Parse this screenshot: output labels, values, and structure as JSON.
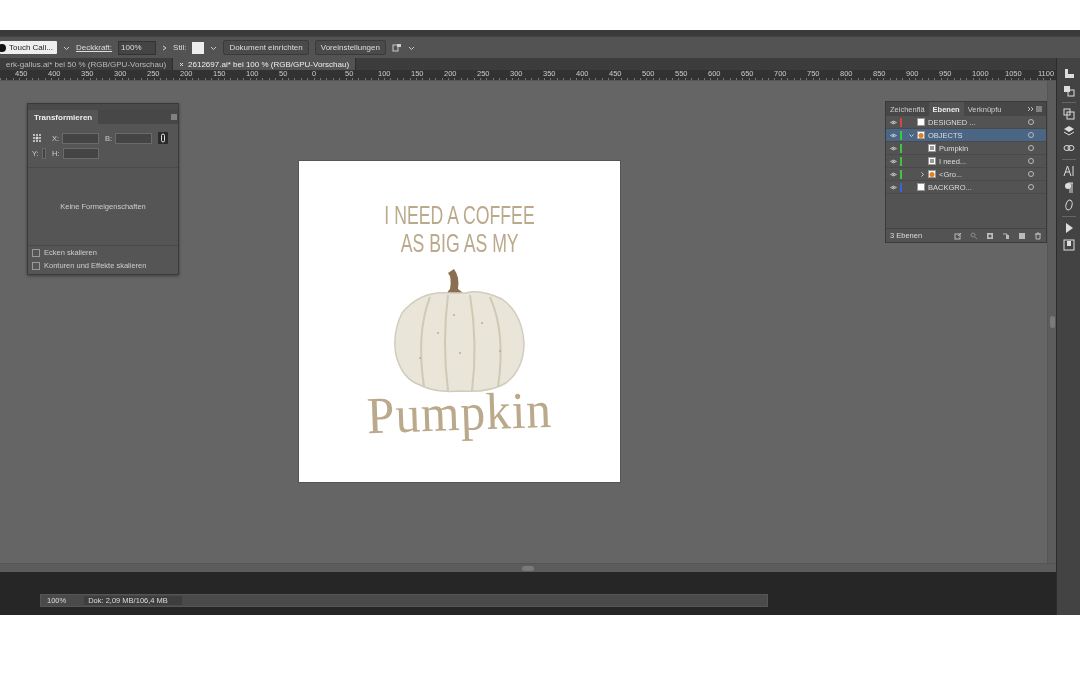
{
  "control_bar": {
    "brush": "Touch Call...",
    "opacity_label": "Deckkraft:",
    "opacity_value": "100%",
    "style_label": "Stil:",
    "buttons": [
      "Dokument einrichten",
      "Voreinstellungen"
    ]
  },
  "document_tabs": [
    {
      "title": "erk-gallus.ai* bei 50 % (RGB/GPU-Vorschau)",
      "selected": false
    },
    {
      "title": "2612697.ai* bei 100 % (RGB/GPU-Vorschau)",
      "selected": true
    }
  ],
  "ruler": {
    "labels": [
      "450",
      "400",
      "350",
      "300",
      "250",
      "200",
      "150",
      "100",
      "50",
      "0",
      "50",
      "100",
      "150",
      "200",
      "250",
      "300",
      "350",
      "400",
      "450",
      "500",
      "550",
      "600",
      "650",
      "700",
      "750",
      "800",
      "850",
      "900",
      "950",
      "1000",
      "1050",
      "1100"
    ]
  },
  "transform_panel": {
    "title": "Transformieren",
    "fields": [
      "X:",
      "B:",
      "Y:",
      "H:"
    ],
    "message": "Keine Formeigenschaften",
    "options": [
      {
        "label": "Ecken skalieren",
        "checked": false
      },
      {
        "label": "Konturen und Effekte skalieren",
        "checked": false
      }
    ]
  },
  "layers_panel": {
    "tabs": [
      {
        "label": "Zeichenflä",
        "selected": false
      },
      {
        "label": "Ebenen",
        "selected": true
      },
      {
        "label": "Verknüpfu",
        "selected": false
      }
    ],
    "layers": [
      {
        "name": "DESIGNED ...",
        "color": "#e04040",
        "selected": false
      },
      {
        "name": "OBJECTS",
        "color": "#3cc83c",
        "selected": true,
        "expanded": true,
        "children": [
          {
            "name": "Pumpkin",
            "selected": false
          },
          {
            "name": "I need...",
            "selected": false
          },
          {
            "name": "<Gro...",
            "selected": false,
            "expanded": false
          }
        ]
      },
      {
        "name": "BACKGRO...",
        "color": "#4060e0",
        "selected": false
      }
    ],
    "footer": "3 Ebenen"
  },
  "artboard": {
    "headline": [
      "I NEED A COFFEE",
      "AS BIG AS MY"
    ],
    "script": "Pumpkin"
  },
  "status_bar": {
    "zoom": "100%",
    "info": "Dok: 2,09 MB/106,4 MB"
  }
}
